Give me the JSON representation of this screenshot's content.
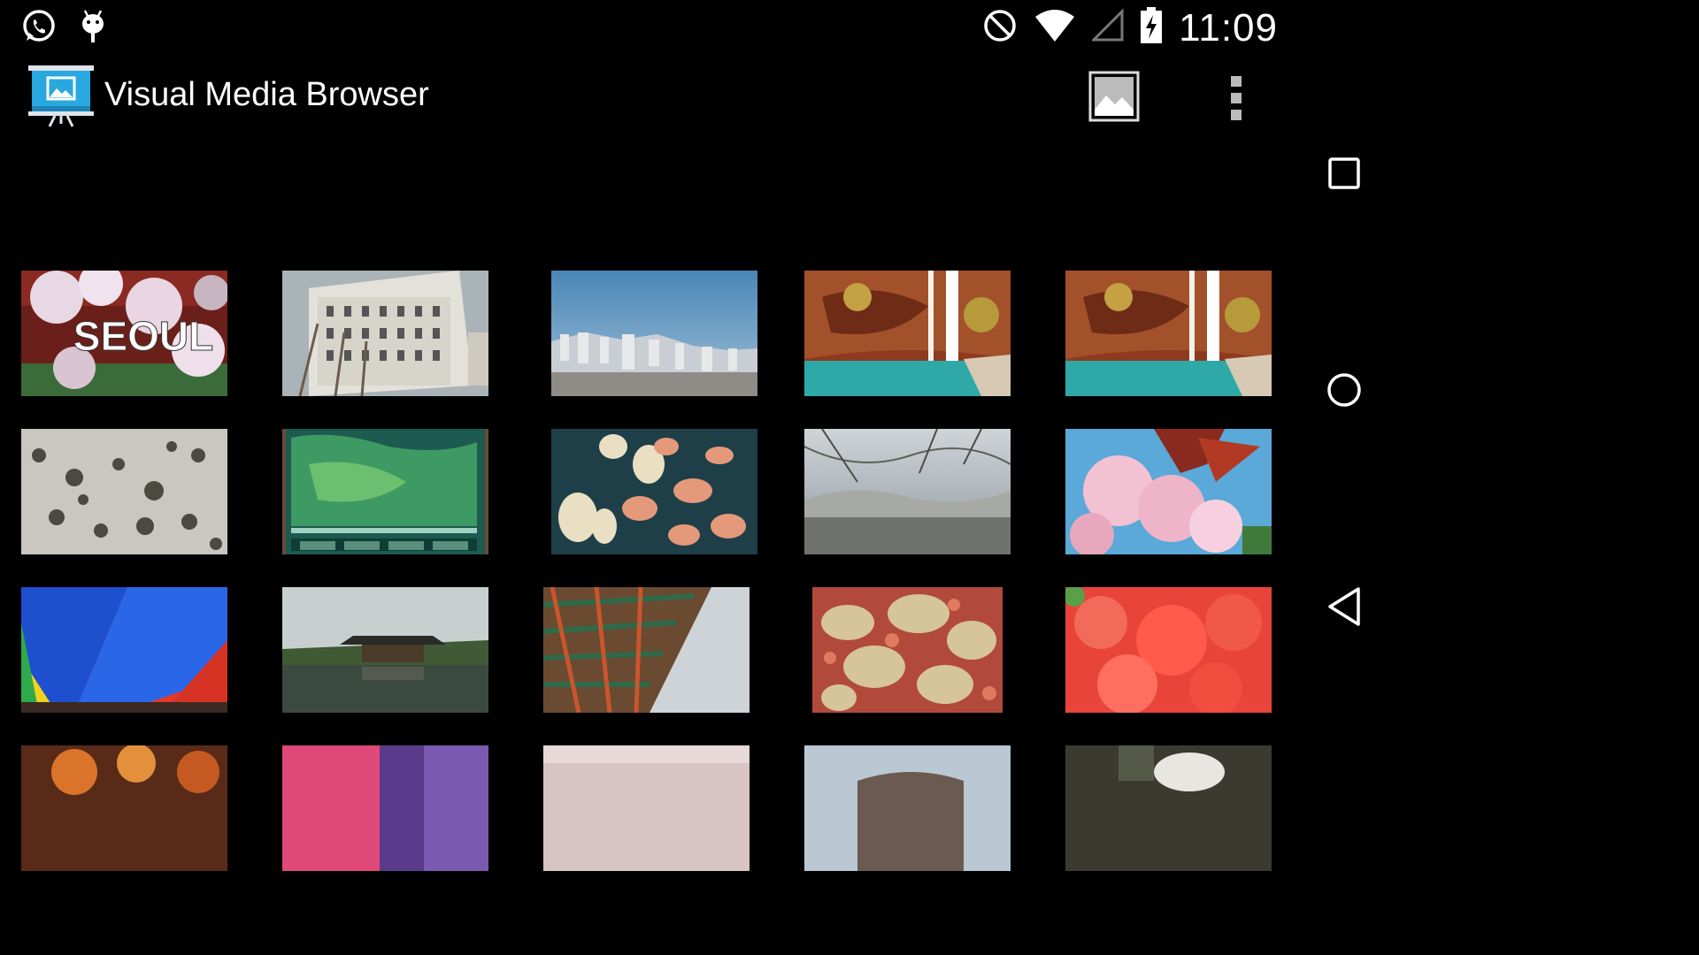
{
  "status_bar": {
    "left_icons": [
      "whatsapp-icon",
      "android-debug-icon"
    ],
    "right_icons": [
      "do-not-disturb-icon",
      "wifi-icon",
      "cell-signal-icon",
      "battery-charging-icon"
    ],
    "time": "11:09"
  },
  "action_bar": {
    "app_icon": "slideshow-presentation-icon",
    "title": "Visual Media Browser",
    "actions": [
      "gallery-image-icon",
      "overflow-menu-icon"
    ]
  },
  "nav_bar": {
    "buttons": [
      "recents-icon",
      "home-icon",
      "back-icon"
    ]
  },
  "thumbnails": [
    {
      "label": "SEOUL"
    },
    {},
    {},
    {},
    {},
    {},
    {},
    {},
    {},
    {},
    {},
    {},
    {},
    {},
    {},
    {},
    {},
    {},
    {},
    {}
  ],
  "colors": {
    "background": "#000000",
    "icon_accent": "#29a8e0",
    "text": "#ffffff"
  }
}
